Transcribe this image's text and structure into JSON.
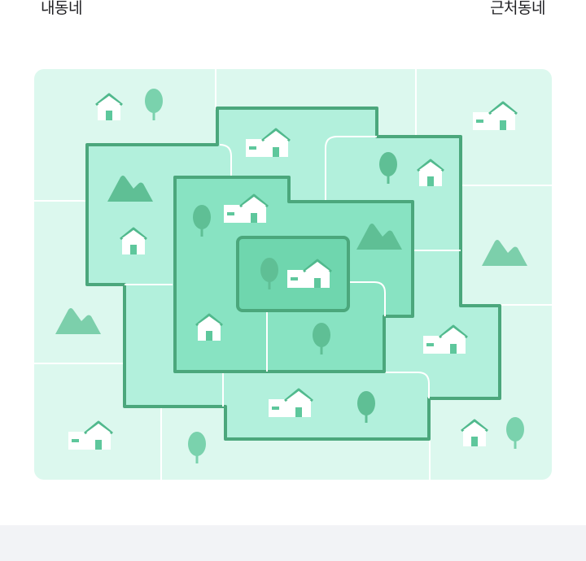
{
  "range_labels": {
    "left": "내동네",
    "right": "근처동네"
  },
  "range_level": 0,
  "colors": {
    "map_bg": "#dcf8ee",
    "zone_outer": "#b2f0dc",
    "zone_middle": "#a3ebd2",
    "zone_inner": "#88e3c2",
    "zone_core": "#6fd6ae",
    "border": "#4ba77c",
    "house_roof": "#51b98d",
    "house_door": "#5ec79c",
    "tree": "#7ad2ad",
    "mountain": "#7ccfab",
    "divider": "#ffffff",
    "bottom_strip": "#f2f3f6"
  },
  "icons": [
    "house-icon",
    "tree-icon",
    "mountain-icon"
  ]
}
